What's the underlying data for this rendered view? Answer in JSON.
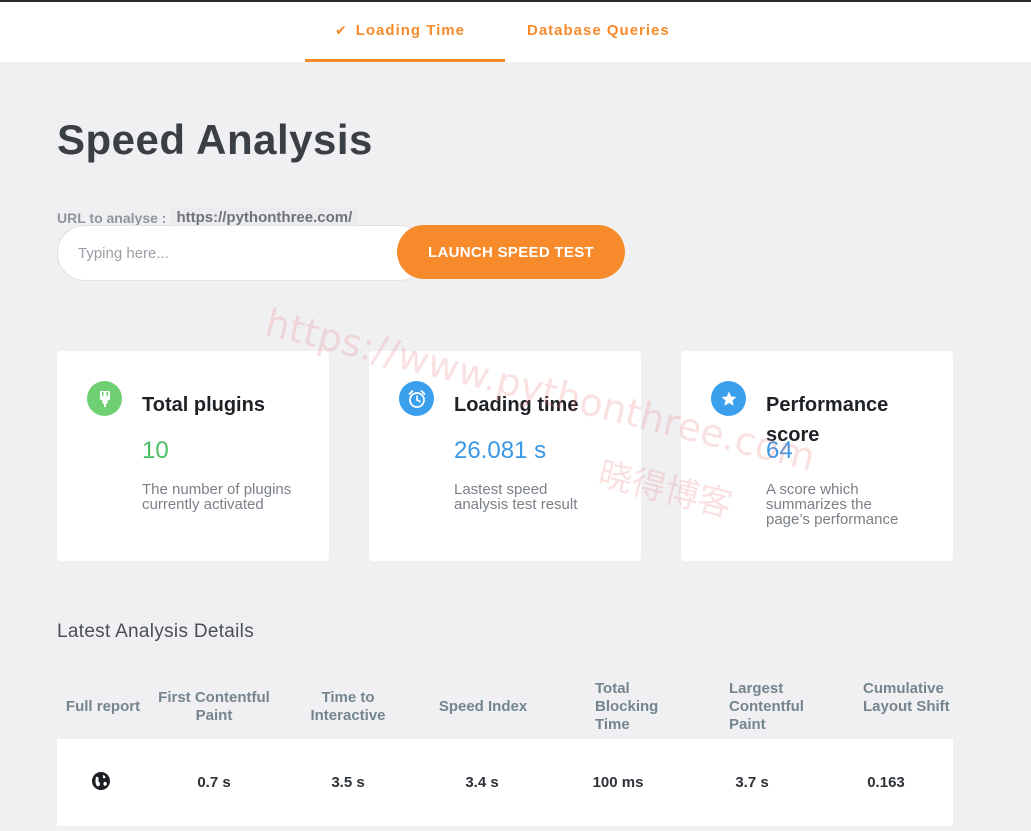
{
  "tabs": [
    {
      "label": "Loading Time",
      "active": true
    },
    {
      "label": "Database Queries",
      "active": false
    }
  ],
  "page_title": "Speed Analysis",
  "url_form": {
    "label": "URL to analyse :",
    "url_value": "https://pythonthree.com/",
    "placeholder": "Typing here...",
    "button_label": "LAUNCH SPEED TEST"
  },
  "cards": [
    {
      "title": "Total plugins",
      "value": "10",
      "description": "The number of plugins currently activated",
      "icon": "plugin-icon"
    },
    {
      "title": "Loading time",
      "value": "26.081 s",
      "description": "Lastest speed analysis test result",
      "icon": "clock-icon"
    },
    {
      "title": "Performance score",
      "value": "64",
      "description": "A score which summarizes the page’s performance",
      "icon": "star-icon"
    }
  ],
  "details": {
    "title": "Latest Analysis Details",
    "columns": [
      "Full report",
      "First Contentful Paint",
      "Time to Interactive",
      "Speed Index",
      "Total Blocking Time",
      "Largest Contentful Paint",
      "Cumulative Layout Shift"
    ],
    "row": {
      "report_icon": "globe-icon",
      "values": [
        "0.7 s",
        "3.5 s",
        "3.4 s",
        "100 ms",
        "3.7 s",
        "0.163"
      ]
    }
  },
  "watermark": {
    "line1": "https://www.pythonthree.com",
    "line2": "晓得博客"
  },
  "colors": {
    "accent": "#f78b2b",
    "green": "#4bbf64",
    "blue": "#3a98e6",
    "background": "#f0f0f2"
  }
}
